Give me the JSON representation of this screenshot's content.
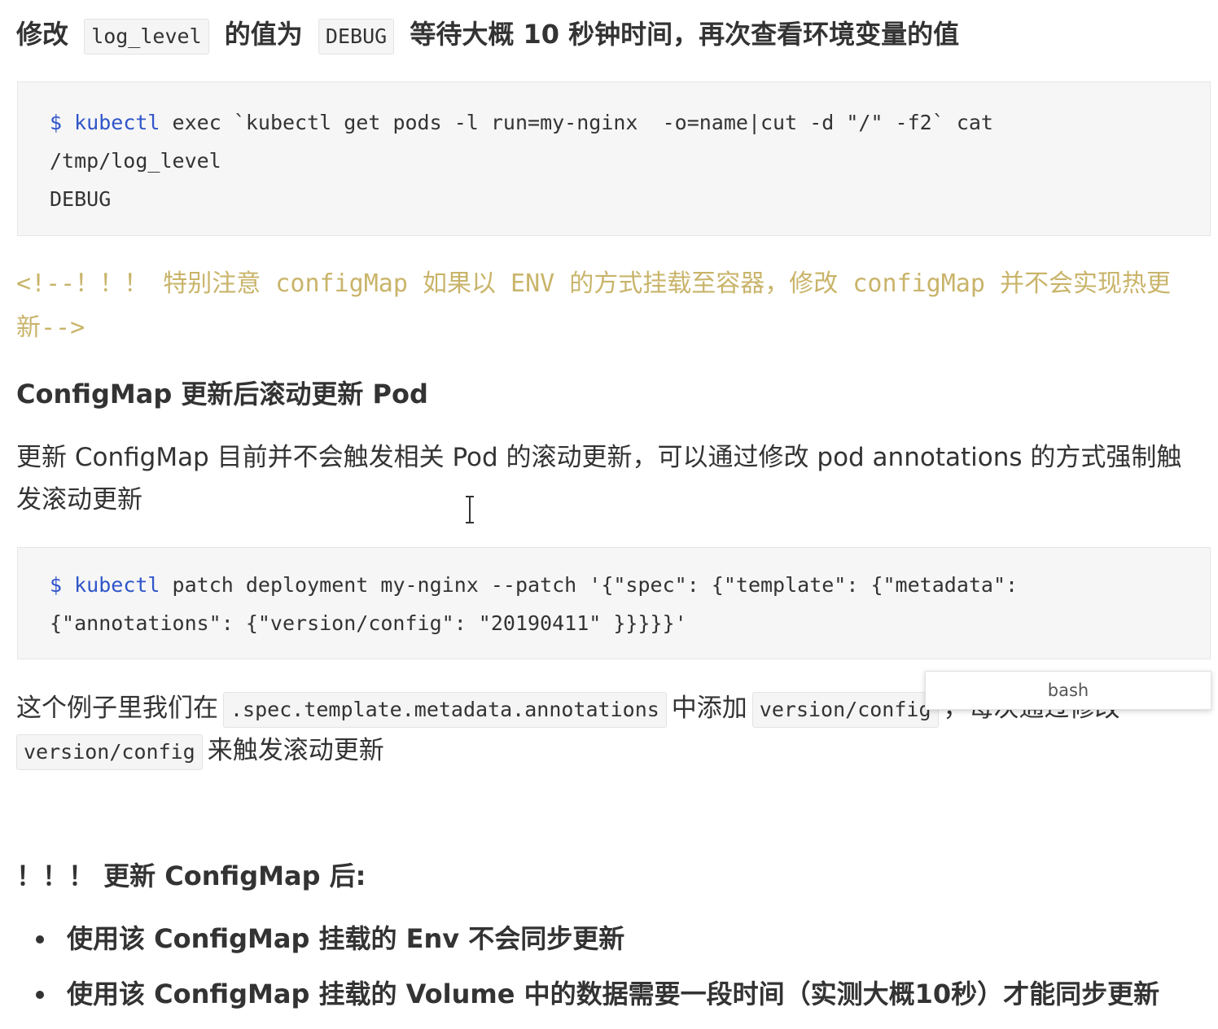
{
  "top_heading": {
    "prefix": "修改",
    "code1": "log_level",
    "middle": "的值为",
    "code2": "DEBUG",
    "suffix": "等待大概 10 秒钟时间，再次查看环境变量的值"
  },
  "code_block_1": {
    "prompt": "$",
    "cmd": "kubectl",
    "line1_rest": " exec `kubectl get pods -l run=my-nginx  -o=name|cut -d \"/\" -f2` cat",
    "line2": "/tmp/log_level",
    "line3": "DEBUG"
  },
  "comment": {
    "text": "<!--！！！ 特别注意 configMap 如果以 ENV 的方式挂载至容器，修改 configMap 并不会实现热更新-->"
  },
  "section_heading": "ConfigMap 更新后滚动更新 Pod",
  "paragraph_1": "更新 ConfigMap 目前并不会触发相关 Pod 的滚动更新，可以通过修改 pod annotations 的方式强制触发滚动更新",
  "code_block_2": {
    "prompt": "$",
    "cmd": "kubectl",
    "line1_rest": " patch deployment my-nginx --patch '{\"spec\": {\"template\": {\"metadata\":",
    "line2": "{\"annotations\": {\"version/config\": \"20190411\" }}}}}'"
  },
  "paragraph_2": {
    "part1": "这个例子里我们在",
    "code1": ".spec.template.metadata.annotations",
    "part2": "中添加",
    "code2": "version/config",
    "part3": "，每次通过修改",
    "code3": "version/config",
    "part4": "来触发滚动更新"
  },
  "tooltip": {
    "label": "bash"
  },
  "warning_heading": "！！！ 更新 ConfigMap 后:",
  "bullets": [
    "使用该 ConfigMap 挂载的 Env 不会同步更新",
    "使用该 ConfigMap 挂载的 Volume 中的数据需要一段时间（实测大概10秒）才能同步更新"
  ]
}
